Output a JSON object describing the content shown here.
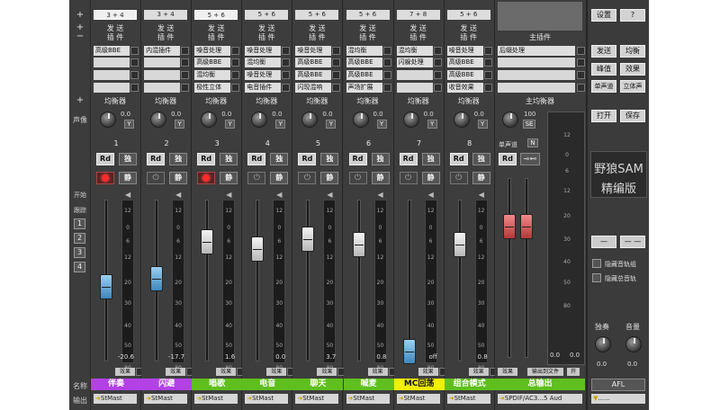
{
  "left_labels": {
    "plus_top": "+",
    "plus_send": "+",
    "minus_insert": "−",
    "plus_eq": "+",
    "pan": "声像",
    "start": "开始",
    "track": "跟踪",
    "groups": [
      "1",
      "2",
      "3",
      "4"
    ],
    "name": "名称",
    "output": "输出"
  },
  "header_labels": {
    "send": "发 送",
    "insert": "插 件",
    "eq": "均衡器",
    "solo": "独",
    "mute": "静",
    "rd": "Rd",
    "effect": "效果"
  },
  "channels": [
    {
      "num": "1",
      "io": "3 + 4",
      "io_selected": true,
      "inserts": [
        "高级BBE",
        "",
        "",
        ""
      ],
      "pan": "0.0",
      "rec": true,
      "fader_color": "blue",
      "fader_level": 0.5,
      "db": "-20.6",
      "name": "伴奏",
      "name_color": "#b341e6",
      "output": "StMast"
    },
    {
      "num": "2",
      "io": "3 + 4",
      "io_selected": false,
      "inserts": [
        "内混插件",
        "",
        "",
        ""
      ],
      "pan": "0.0",
      "rec": false,
      "fader_color": "blue",
      "fader_level": 0.55,
      "db": "-17.7",
      "name": "闪避",
      "name_color": "#b341e6",
      "output": "StMast"
    },
    {
      "num": "3",
      "io": "5 + 6",
      "io_selected": true,
      "inserts": [
        "噪音处理",
        "高级BBE",
        "混均衡",
        "极性立体"
      ],
      "pan": "0.0",
      "rec": true,
      "fader_color": "white",
      "fader_level": 0.8,
      "db": "1.6",
      "name": "唱歌",
      "name_color": "#5fbf1e",
      "output": "StMast"
    },
    {
      "num": "4",
      "io": "5 + 6",
      "io_selected": false,
      "inserts": [
        "噪音处理",
        "混均衡",
        "噪音处理",
        "电音插件"
      ],
      "pan": "0.0",
      "rec": false,
      "fader_color": "white",
      "fader_level": 0.75,
      "db": "0.0",
      "name": "电音",
      "name_color": "#5fbf1e",
      "output": "StMast"
    },
    {
      "num": "5",
      "io": "5 + 6",
      "io_selected": false,
      "inserts": [
        "噪音处理",
        "高级BBE",
        "高级BBE",
        "闪现混响"
      ],
      "pan": "0.0",
      "rec": false,
      "fader_color": "white",
      "fader_level": 0.82,
      "db": "3.7",
      "name": "聊天",
      "name_color": "#5fbf1e",
      "output": "StMast"
    },
    {
      "num": "6",
      "io": "5 + 6",
      "io_selected": false,
      "inserts": [
        "混均衡",
        "高级BBE",
        "高级BBE",
        "声场扩展"
      ],
      "pan": "0.0",
      "rec": false,
      "fader_color": "white",
      "fader_level": 0.78,
      "db": "0.8",
      "name": "喊麦",
      "name_color": "#5fbf1e",
      "output": "StMast"
    },
    {
      "num": "7",
      "io": "7 + 8",
      "io_selected": false,
      "inserts": [
        "混均衡",
        "闪躲处理",
        "",
        ""
      ],
      "pan": "0.0",
      "rec": false,
      "fader_color": "blue",
      "fader_level": 0.06,
      "db": "off",
      "name": "MC回荡",
      "name_color": "#f0f000",
      "name_text_color": "#111111",
      "output": "StMast"
    },
    {
      "num": "8",
      "io": "5 + 6",
      "io_selected": false,
      "inserts": [
        "噪音处理",
        "高级BBE",
        "高级BBE",
        "收音效果"
      ],
      "pan": "0.0",
      "rec": false,
      "fader_color": "white",
      "fader_level": 0.78,
      "db": "0.8",
      "name": "组合模式",
      "name_color": "#5fbf1e",
      "output": "StMast"
    }
  ],
  "master": {
    "header": "主插件",
    "inserts": [
      "后缀处理",
      "",
      "",
      ""
    ],
    "eq_label": "主均衡器",
    "pan_value": "100",
    "se": "SE",
    "mono": "单声道",
    "n": "N",
    "db_left": "0.0",
    "db_right": "0.0",
    "effect": "效果",
    "output_file": "输出到文件",
    "open": "开",
    "name": "总输出",
    "name_color": "#5fbf1e",
    "output": "SPDIF/AC3...5 Aud",
    "fader_level": 0.78
  },
  "scale_marks": [
    "12",
    "0",
    "6",
    "12",
    "20",
    "30",
    "40",
    "50",
    "80"
  ],
  "master_scale": [
    "12",
    "0",
    "6",
    "12",
    "20",
    "30",
    "40",
    "50",
    "80"
  ],
  "right_panel": {
    "settings": "设置",
    "help": "?",
    "send": "发送",
    "eq": "均衡",
    "peak": "峰值",
    "effect": "效果",
    "mono": "单声道",
    "stereo": "立体声",
    "open": "打开",
    "save": "保存",
    "logo_line1": "野狼SAM",
    "logo_line2": "精编版",
    "minus1": "—",
    "minus2": "— —",
    "hide_track_group": "隐藏音轨组",
    "hide_master": "隐藏总音轨",
    "solo_label": "独奏",
    "volume_label": "音量",
    "solo_val": "0.0",
    "volume_val": "0.0",
    "afl": "AFL",
    "bottom_select": "......"
  }
}
